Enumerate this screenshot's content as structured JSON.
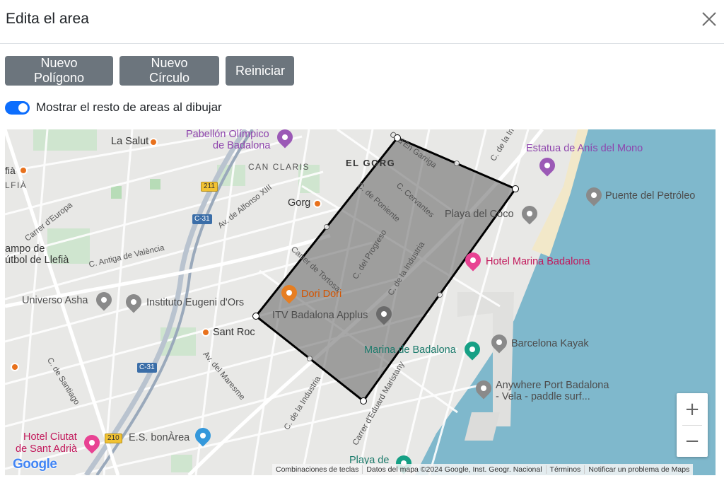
{
  "modal": {
    "title": "Edita el area",
    "close_icon": "close-icon"
  },
  "toolbar": {
    "new_polygon": "Nuevo Polígono",
    "new_circle": "Nuevo Círculo",
    "reset": "Reiniciar"
  },
  "toggle": {
    "label": "Mostrar el resto de areas al dibujar",
    "checked": true
  },
  "colors": {
    "button_bg": "#6c757d",
    "switch_on": "#0d6efd",
    "sea": "#7fb8cc",
    "polygon_fill": "#606060",
    "polygon_stroke": "#000000"
  },
  "map": {
    "places": {
      "pabellon_1": "Pabellón Olímpico",
      "pabellon_2": "de Badalona",
      "la_salut": "La Salut",
      "can_claris": "CAN CLARIS",
      "el_gorg": "EL GORG",
      "gorg": "Gorg",
      "fia": "fià",
      "lfia": "LFIÀ",
      "estatua": "Estatua de Anís del Mono",
      "puente": "Puente del Petróleo",
      "playa_coco": "Playa del Coco",
      "hotel_marina": "Hotel Marina Badalona",
      "campo_1": "ampo de",
      "campo_2": "útbol de Llefià",
      "universo": "Universo Asha",
      "instituto": "Instituto Eugeni d'Ors",
      "dori": "Dori Dori",
      "itv": "ITV Badalona Applus",
      "sant_roc": "Sant Roc",
      "marina": "Marina de Badalona",
      "kayak": "Barcelona Kayak",
      "anywhere_1": "Anywhere Port Badalona",
      "anywhere_2": "- Vela - paddle surf...",
      "hotel_ciutat_1": "Hotel Ciutat",
      "hotel_ciutat_2": "de Sant Adrià",
      "bonarea": "E.S. bonÀrea",
      "playa_de": "Playa de"
    },
    "streets": {
      "europa": "Carrer d'Europa",
      "alfonso": "Av. de Alfonso XIII",
      "valencia": "C. Antiga de València",
      "garriga": "C. d'En Garriga",
      "poniente": "C. de Poniente",
      "cervantes": "C. Cervantes",
      "tortosa": "Carrer de Tortosa",
      "progreso": "C. del Progreso",
      "industria_1": "C. de la Industria",
      "industria_2": "C. de la Industria",
      "industria_top": "C. de la Ind",
      "maresme": "Av. del Maresme",
      "santiago": "C. de Santiago",
      "eduard": "Carrer d'Eduard Maristany"
    },
    "badges": {
      "c31_a": "C-31",
      "c31_b": "C-31",
      "r211": "211",
      "r210": "210"
    },
    "zoom": {
      "in": "+",
      "out": "−"
    },
    "logo": "Google",
    "attribution": {
      "shortcuts": "Combinaciones de teclas",
      "data": "Datos del mapa ©2024 Google, Inst. Geogr. Nacional",
      "terms": "Términos",
      "report": "Notificar un problema de Maps"
    }
  }
}
